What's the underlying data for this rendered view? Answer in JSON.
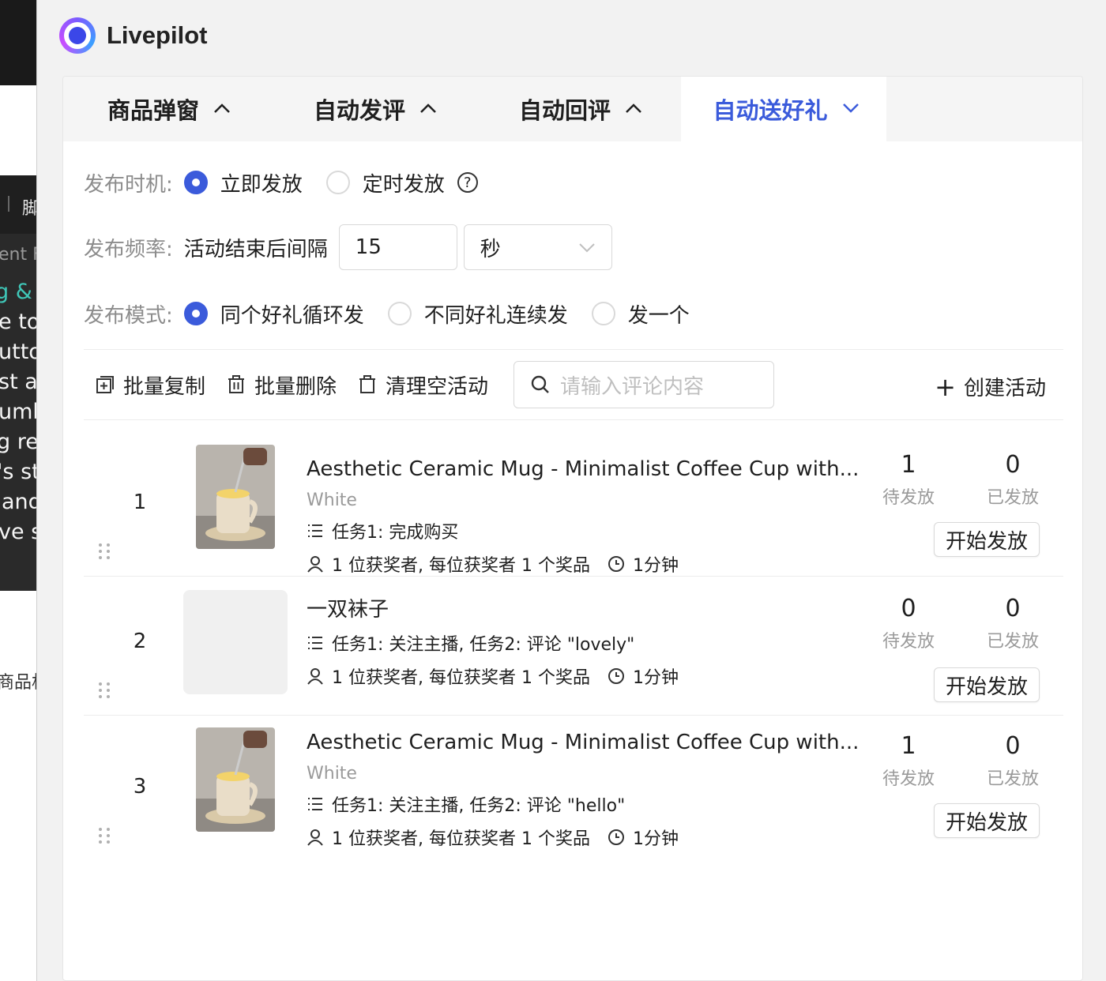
{
  "background_app": {
    "bar_text": "脚",
    "lines": [
      "ent F",
      "g & C",
      "e to",
      "utto",
      "st ap",
      "umb",
      "g rei",
      "'s st",
      "and",
      "ve sl"
    ],
    "bottom_text": "商品相"
  },
  "app": {
    "title": "Livepilot"
  },
  "tabs": [
    {
      "label": "商品弹窗",
      "expanded": false
    },
    {
      "label": "自动发评",
      "expanded": false
    },
    {
      "label": "自动回评",
      "expanded": false
    },
    {
      "label": "自动送好礼",
      "expanded": true
    }
  ],
  "form": {
    "timing": {
      "label": "发布时机:",
      "options": [
        "立即发放",
        "定时发放"
      ],
      "selected": "立即发放",
      "help_icon": "question-circle-icon"
    },
    "frequency": {
      "label": "发布频率:",
      "prefix": "活动结束后间隔",
      "value": "15",
      "unit": "秒"
    },
    "mode": {
      "label": "发布模式:",
      "options": [
        "同个好礼循环发",
        "不同好礼连续发",
        "发一个"
      ],
      "selected": "同个好礼循环发"
    }
  },
  "toolbar": {
    "batch_copy": "批量复制",
    "batch_delete": "批量删除",
    "clear_empty": "清理空活动",
    "search_placeholder": "请输入评论内容",
    "create": "创建活动"
  },
  "items": [
    {
      "index": "1",
      "title": "Aesthetic Ceramic Mug - Minimalist Coffee Cup with...",
      "variant": "White",
      "task": "任务1: 完成购买",
      "winners": "1 位获奖者, 每位获奖者 1 个奖品",
      "duration": "1分钟",
      "pending": "1",
      "pending_label": "待发放",
      "sent": "0",
      "sent_label": "已发放",
      "action": "开始发放"
    },
    {
      "index": "2",
      "title": "一双袜子",
      "variant": "",
      "task": "任务1: 关注主播, 任务2: 评论 \"lovely\"",
      "winners": "1 位获奖者, 每位获奖者 1 个奖品",
      "duration": "1分钟",
      "pending": "0",
      "pending_label": "待发放",
      "sent": "0",
      "sent_label": "已发放",
      "action": "开始发放"
    },
    {
      "index": "3",
      "title": "Aesthetic Ceramic Mug - Minimalist Coffee Cup with...",
      "variant": "White",
      "task": "任务1: 关注主播, 任务2: 评论 \"hello\"",
      "winners": "1 位获奖者, 每位获奖者 1 个奖品",
      "duration": "1分钟",
      "pending": "1",
      "pending_label": "待发放",
      "sent": "0",
      "sent_label": "已发放",
      "action": "开始发放"
    }
  ],
  "colors": {
    "accent": "#3b5bdb",
    "muted": "#8c8c8c",
    "border": "#d9d9d9"
  }
}
